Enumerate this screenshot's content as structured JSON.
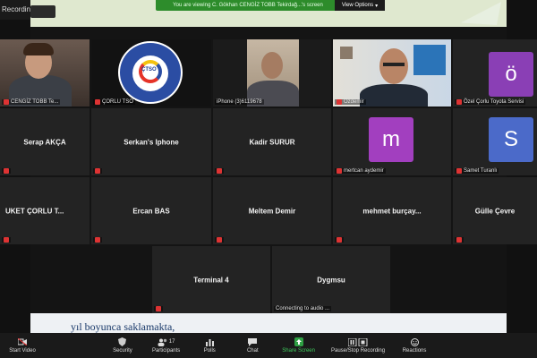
{
  "recording": "Recording...",
  "banner": {
    "message": "You are viewing C. Gökhan CENGİZ TOBB Tekirdağ...'s screen",
    "view_options": "View Options"
  },
  "shared_text": "yıl boyunca saklamakta,",
  "tiles": [
    {
      "id": "t1",
      "label": "CENGİZ TOBB Te...",
      "muted": true,
      "video": true
    },
    {
      "id": "t2",
      "label": "ÇORLU TSO",
      "muted": true,
      "video": true,
      "active": true
    },
    {
      "id": "t3",
      "label": "iPhone (3)6119678",
      "muted": false,
      "video": true
    },
    {
      "id": "t4",
      "label": "Özdemir",
      "muted": true,
      "video": true
    },
    {
      "id": "t5",
      "label": "Özel Çorlu Toyota Servisi",
      "muted": true,
      "avatar": "ö",
      "avatar_color": "#8a3fb5"
    },
    {
      "id": "t6",
      "name": "Serap AKÇA",
      "muted": true
    },
    {
      "id": "t7",
      "name": "Serkan's Iphone",
      "muted": true
    },
    {
      "id": "t8",
      "name": "Kadir SURUR",
      "muted": true
    },
    {
      "id": "t9",
      "label": "mertcan aydemir",
      "muted": true,
      "avatar": "m",
      "avatar_color": "#a23fbf"
    },
    {
      "id": "t10",
      "label": "Samet Turanlı",
      "muted": true,
      "avatar": "S",
      "avatar_color": "#4b6ac9"
    },
    {
      "id": "t11",
      "name": "UKET ÇORLU T...",
      "muted": true
    },
    {
      "id": "t12",
      "name": "Ercan BAS",
      "muted": true
    },
    {
      "id": "t13",
      "name": "Meltem Demir",
      "muted": true
    },
    {
      "id": "t14",
      "name": "mehmet burçay...",
      "muted": true
    },
    {
      "id": "t15",
      "name": "Gülle Çevre",
      "muted": true
    },
    {
      "id": "t16",
      "name": "Terminal 4",
      "muted": true
    },
    {
      "id": "t17",
      "name": "Dygmsu",
      "muted": false,
      "status": "Connecting to audio ..."
    }
  ],
  "logo_text": "ÇTSO",
  "toolbar": {
    "start_video": "Start Video",
    "security": "Security",
    "participants": "Participants",
    "participants_count": "17",
    "polls": "Polls",
    "chat": "Chat",
    "share_screen": "Share Screen",
    "recording": "Pause/Stop Recording",
    "reactions": "Reactions"
  }
}
